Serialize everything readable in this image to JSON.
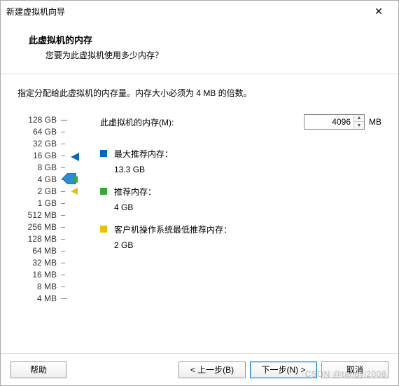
{
  "window": {
    "title": "新建虚拟机向导"
  },
  "header": {
    "title": "此虚拟机的内存",
    "subtitle": "您要为此虚拟机使用多少内存？"
  },
  "instruction": "指定分配给此虚拟机的内存量。内存大小必须为 4 MB 的倍数。",
  "memory": {
    "label": "此虚拟机的内存(M):",
    "value": "4096",
    "unit": "MB",
    "underline": "M"
  },
  "scale": [
    "128 GB",
    "64 GB",
    "32 GB",
    "16 GB",
    "8 GB",
    "4 GB",
    "2 GB",
    "1 GB",
    "512 MB",
    "256 MB",
    "128 MB",
    "64 MB",
    "32 MB",
    "16 MB",
    "8 MB",
    "4 MB"
  ],
  "legends": {
    "max": {
      "label": "最大推荐内存：",
      "value": "13.3 GB"
    },
    "rec": {
      "label": "推荐内存：",
      "value": "4 GB"
    },
    "min": {
      "label": "客户机操作系统最低推荐内存：",
      "value": "2 GB"
    }
  },
  "buttons": {
    "help": "帮助",
    "back": "< 上一步(B)",
    "next": "下一步(N) >",
    "cancel": "取消"
  },
  "watermark": "CSDN @tangyi2008"
}
